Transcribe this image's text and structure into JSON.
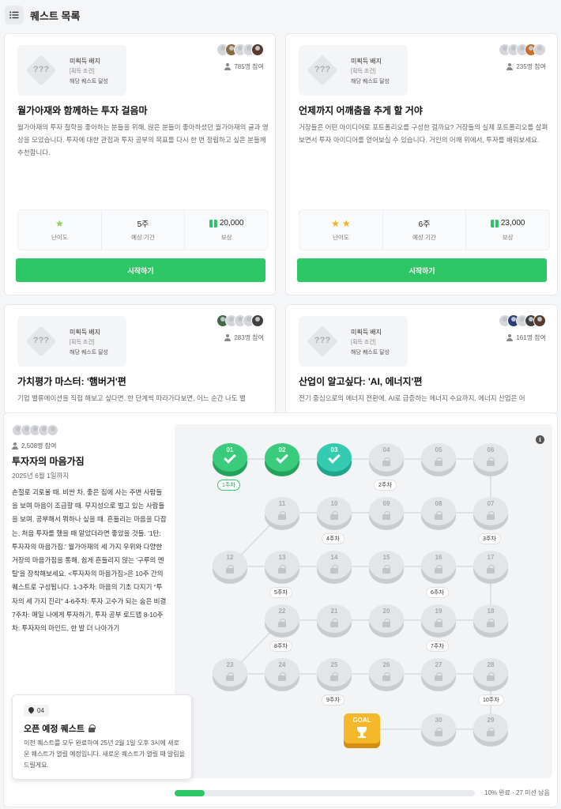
{
  "header": {
    "title": "퀘스트 목록",
    "menu_icon": "list-icon"
  },
  "cards": [
    {
      "badge": {
        "title": "미획득 배지",
        "condition": "[획득 조건]",
        "requirement": "해당 퀘스트 달성"
      },
      "participants": "785명 참여",
      "title": "월가아재와 함께하는 투자 걸음마",
      "description": "월가아재의 투자 철학을 좋아하는 분들을 위해, 많은 분들이 좋아하셨던 월가아재의 글과 영상을 모았습니다. 투자에 대한 관점과 투자 공부의 목표를 다시 한 번 정립하고 싶은 분들께 추천합니다.",
      "difficulty_label": "난이도",
      "difficulty_stars": 1,
      "duration": "5주",
      "duration_label": "예상 기간",
      "reward": "20,000",
      "reward_label": "보상",
      "button": "시작하기"
    },
    {
      "badge": {
        "title": "미획득 배지",
        "condition": "[획득 조건]",
        "requirement": "해당 퀘스트 달성"
      },
      "participants": "235명 참여",
      "title": "언제까지 어깨춤을 추게 할 거야",
      "description": "거장들은 어떤 아이디어로 포트폴리오를 구성한 걸까요? 거장들의 실제 포트폴리오를 살펴보면서 투자 아이디어를 얻어보실 수 있습니다. 거인의 어깨 위에서, 투자를 배워보세요.",
      "difficulty_label": "난이도",
      "difficulty_stars": 2,
      "duration": "6주",
      "duration_label": "예상 기간",
      "reward": "23,000",
      "reward_label": "보상",
      "button": "시작하기"
    },
    {
      "badge": {
        "title": "미획득 배지",
        "condition": "[획득 조건]",
        "requirement": "해당 퀘스트 달성"
      },
      "participants": "283명 참여",
      "title": "가치평가 마스터: '햄버거'편",
      "description": "기업 밸류에이션을 직접 해보고 싶다면. 한 단계씩 따라가다보면, 어느 순간 나도 밸"
    },
    {
      "badge": {
        "title": "미획득 배지",
        "condition": "[획득 조건]",
        "requirement": "해당 퀘스트 달성"
      },
      "participants": "161명 참여",
      "title": "산업이 알고싶다: 'AI, 에너지'편",
      "description": "전기 중심으로의 에너지 전환에, AI로 급증하는 에너지 수요까지. 에너지 산업은 어"
    }
  ],
  "detail": {
    "participants": "2,508명 참여",
    "title": "투자자의 마음가짐",
    "deadline": "2025년 6월 1일까지",
    "description": "손절로 괴로울 때. 비싼 차, 좋은 집에 사는 주변 사람들을 보며 마음이 조급할 때. 무지성으로 벌고 있는 사람들을 보며, 공부해서 뭐하나 싶을 때. 흔들리는 마음을 다잡는, 처음 투자를 했을 때 알았더라면 좋았을 것들. '1탄: 투자자의 마음가짐.' 월가아재의 세 가지 우위와 다양한 거장의 마음가짐을 통해, 쉽게 흔들리지 않는 '구루의 멘탈'을 장착해보세요. <투자자의 마음가짐>은 10주 간의 퀘스트로 구성됩니다. 1-3주차: 마음의 기초 다지기 \"투자의 세 가지 진리\" 4-6주차: 투자 고수가 되는 숨은 비결 7주차: 매일 나에게 투자하기, 투자 공부 로드맵 8-10주차: 투자자의 마인드, 한 발 더 나아가기",
    "upcoming": {
      "number": "04",
      "title": "오픈 예정 퀘스트",
      "description": "이전 퀘스트를 모두 완료하여 25년 2월 1일 오후 3시에 새로운 퀘스트가 열릴 예정입니다. 새로운 퀘스트가 열릴 때 알림을 드릴게요."
    },
    "progress": {
      "percent": 10,
      "text": "10% 완료 · 27 미션 남음"
    },
    "map": {
      "goal_label": "GOAL",
      "nodes": [
        "01",
        "02",
        "03",
        "04",
        "05",
        "06",
        "11",
        "10",
        "09",
        "08",
        "07",
        "12",
        "13",
        "14",
        "15",
        "16",
        "17",
        "22",
        "21",
        "20",
        "19",
        "18",
        "23",
        "24",
        "25",
        "26",
        "27",
        "28",
        "30",
        "29"
      ],
      "completed": [
        "01",
        "02",
        "03"
      ],
      "weeks": [
        "1주차",
        "2주차",
        "3주차",
        "4주차",
        "5주차",
        "6주차",
        "7주차",
        "8주차",
        "9주차",
        "10주차"
      ]
    }
  },
  "colors": {
    "accent": "#2dc766",
    "done": "#3acb7c",
    "done_teal": "#35cbb1",
    "goal": "#f5b82a",
    "locked": "#e4e5e8"
  }
}
